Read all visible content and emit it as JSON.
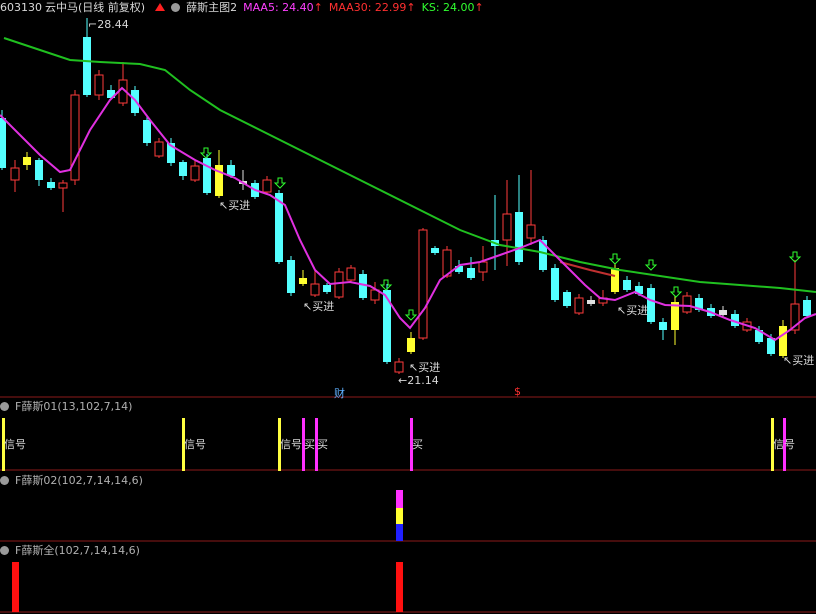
{
  "header": {
    "stock_code": "603130",
    "stock_name": "云中马",
    "period_mode": "(日线 前复权)",
    "main_indicator": "薛斯主图2",
    "maa5": "MAA5: 24.40",
    "maa30": "MAA30: 22.99",
    "ks": "KS: 24.00",
    "colors": {
      "pink": "#ff40ff",
      "red": "#ff3030",
      "green": "#30ff30"
    }
  },
  "main_chart": {
    "high_label": "28.44",
    "low_label": "21.14",
    "buy_label": "买进",
    "marker_cai": "财",
    "marker_s": "$"
  },
  "panel1": {
    "title": "F薛斯01(13,102,7,14)",
    "signal_label": "信号",
    "buy_label": "买"
  },
  "panel2": {
    "title": "F薛斯02(102,7,14,14,6)"
  },
  "panel3": {
    "title": "F薛斯全(102,7,14,14,6)"
  }
}
